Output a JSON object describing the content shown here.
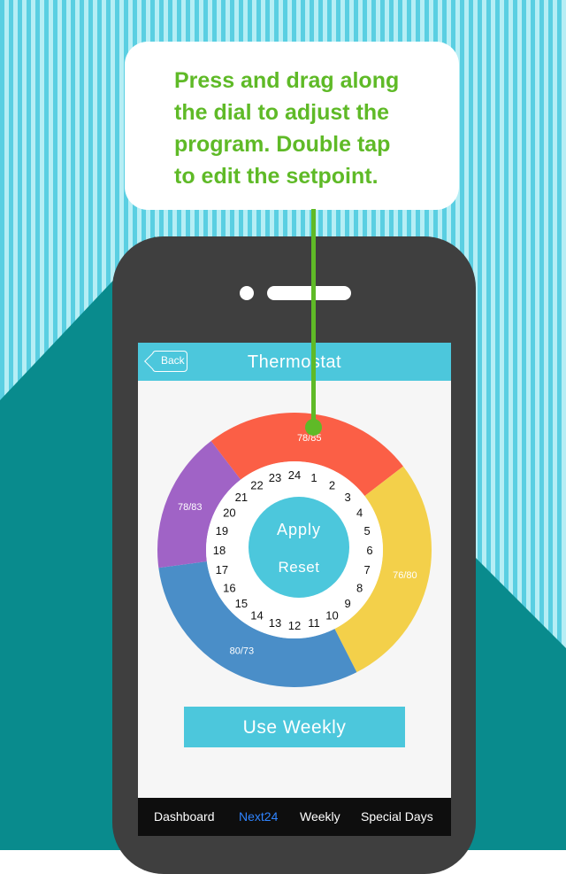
{
  "instruction": {
    "text": "Press and drag along\nthe dial to adjust the\nprogram. Double tap\nto edit the setpoint."
  },
  "header": {
    "back_label": "Back",
    "title": "Thermostat"
  },
  "dial": {
    "segments": [
      {
        "label": "78/85",
        "color": "#fb5f46",
        "start_hour": 21.5,
        "end_hour": 3.5
      },
      {
        "label": "76/80",
        "color": "#f3d04a",
        "start_hour": 3.5,
        "end_hour": 10.2
      },
      {
        "label": "80/73",
        "color": "#4a8ec8",
        "start_hour": 10.2,
        "end_hour": 17.5
      },
      {
        "label": "78/83",
        "color": "#a063c6",
        "start_hour": 17.5,
        "end_hour": 21.5
      }
    ],
    "hours": [
      "1",
      "2",
      "3",
      "4",
      "5",
      "6",
      "7",
      "8",
      "9",
      "10",
      "11",
      "12",
      "13",
      "14",
      "15",
      "16",
      "17",
      "18",
      "19",
      "20",
      "21",
      "22",
      "23",
      "24"
    ],
    "apply_label": "Apply",
    "reset_label": "Reset"
  },
  "use_weekly_label": "Use Weekly",
  "tabs": [
    {
      "label": "Dashboard",
      "active": false
    },
    {
      "label": "Next24",
      "active": true
    },
    {
      "label": "Weekly",
      "active": false
    },
    {
      "label": "Special Days",
      "active": false
    }
  ],
  "colors": {
    "accent": "#4cc7dc",
    "highlight_green": "#5fba27",
    "tab_active": "#2f84ff"
  }
}
